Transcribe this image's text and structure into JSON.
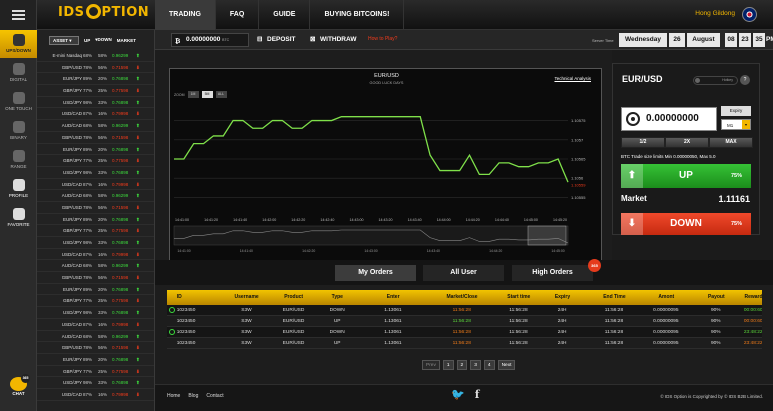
{
  "brand": {
    "logo_left": "IDS",
    "logo_right": "PTION"
  },
  "nav": [
    {
      "label": "TRADING",
      "active": true
    },
    {
      "label": "FAQ"
    },
    {
      "label": "GUIDE"
    },
    {
      "label": "BUYING BITCOINS!"
    }
  ],
  "user": {
    "name": "Hong Gildong"
  },
  "sidebar": [
    {
      "label": "UPS/DOWN",
      "icon": "updown-icon",
      "state": "active"
    },
    {
      "label": "DIGITAL",
      "icon": "digital-icon"
    },
    {
      "label": "ONE TOUCH",
      "icon": "one-touch-icon"
    },
    {
      "label": "BINARY",
      "icon": "binary-icon"
    },
    {
      "label": "RANGE",
      "icon": "range-icon"
    },
    {
      "label": "PROFILE",
      "icon": "profile-icon",
      "state": "on"
    },
    {
      "label": "FAVORITE",
      "icon": "favorite-icon",
      "state": "on"
    }
  ],
  "chat": {
    "label": "CHAT",
    "badge": "365"
  },
  "assets_header": {
    "select": "ASSET",
    "up": "UP",
    "down": "DOWN",
    "market": "MARKET"
  },
  "assets": [
    {
      "name": "E-mini Nasdaq",
      "p1": "68%",
      "p2": "58%",
      "value": "0.96299",
      "dir": "up"
    },
    {
      "name": "GBP/USD",
      "p1": "78%",
      "p2": "56%",
      "value": "0.71598",
      "dir": "down"
    },
    {
      "name": "EUR/JPY",
      "p1": "89%",
      "p2": "20%",
      "value": "0.76898",
      "dir": "up"
    },
    {
      "name": "GBP/JPY",
      "p1": "77%",
      "p2": "25%",
      "value": "0.77598",
      "dir": "down"
    },
    {
      "name": "USD/JPY",
      "p1": "98%",
      "p2": "33%",
      "value": "0.76898",
      "dir": "up"
    },
    {
      "name": "USD/CAD",
      "p1": "87%",
      "p2": "16%",
      "value": "0.79998",
      "dir": "down"
    },
    {
      "name": "AUD/CAD",
      "p1": "68%",
      "p2": "58%",
      "value": "0.96299",
      "dir": "up"
    },
    {
      "name": "GBP/USD",
      "p1": "78%",
      "p2": "56%",
      "value": "0.71598",
      "dir": "down"
    },
    {
      "name": "EUR/JPY",
      "p1": "89%",
      "p2": "20%",
      "value": "0.76898",
      "dir": "up"
    },
    {
      "name": "GBP/JPY",
      "p1": "77%",
      "p2": "25%",
      "value": "0.77598",
      "dir": "down"
    },
    {
      "name": "USD/JPY",
      "p1": "98%",
      "p2": "33%",
      "value": "0.76898",
      "dir": "up"
    },
    {
      "name": "USD/CAD",
      "p1": "87%",
      "p2": "16%",
      "value": "0.79998",
      "dir": "down"
    },
    {
      "name": "AUD/CAD",
      "p1": "68%",
      "p2": "58%",
      "value": "0.96299",
      "dir": "up"
    },
    {
      "name": "GBP/USD",
      "p1": "78%",
      "p2": "56%",
      "value": "0.71598",
      "dir": "down"
    },
    {
      "name": "EUR/JPY",
      "p1": "89%",
      "p2": "20%",
      "value": "0.76898",
      "dir": "up"
    },
    {
      "name": "GBP/JPY",
      "p1": "77%",
      "p2": "25%",
      "value": "0.77598",
      "dir": "down"
    },
    {
      "name": "USD/JPY",
      "p1": "98%",
      "p2": "33%",
      "value": "0.76898",
      "dir": "up"
    },
    {
      "name": "USD/CAD",
      "p1": "87%",
      "p2": "16%",
      "value": "0.79998",
      "dir": "down"
    },
    {
      "name": "AUD/CAD",
      "p1": "68%",
      "p2": "58%",
      "value": "0.96299",
      "dir": "up"
    },
    {
      "name": "GBP/USD",
      "p1": "78%",
      "p2": "56%",
      "value": "0.71598",
      "dir": "down"
    },
    {
      "name": "EUR/JPY",
      "p1": "89%",
      "p2": "20%",
      "value": "0.76898",
      "dir": "up"
    },
    {
      "name": "GBP/JPY",
      "p1": "77%",
      "p2": "25%",
      "value": "0.77598",
      "dir": "down"
    },
    {
      "name": "USD/JPY",
      "p1": "98%",
      "p2": "33%",
      "value": "0.76898",
      "dir": "up"
    },
    {
      "name": "USD/CAD",
      "p1": "87%",
      "p2": "16%",
      "value": "0.79998",
      "dir": "down"
    },
    {
      "name": "AUD/CAD",
      "p1": "68%",
      "p2": "58%",
      "value": "0.96299",
      "dir": "up"
    },
    {
      "name": "GBP/USD",
      "p1": "78%",
      "p2": "56%",
      "value": "0.71598",
      "dir": "down"
    },
    {
      "name": "EUR/JPY",
      "p1": "89%",
      "p2": "20%",
      "value": "0.76898",
      "dir": "up"
    },
    {
      "name": "GBP/JPY",
      "p1": "77%",
      "p2": "25%",
      "value": "0.77598",
      "dir": "down"
    },
    {
      "name": "USD/JPY",
      "p1": "98%",
      "p2": "33%",
      "value": "0.76898",
      "dir": "up"
    },
    {
      "name": "USD/CAD",
      "p1": "87%",
      "p2": "16%",
      "value": "0.79998",
      "dir": "down"
    }
  ],
  "actionbar": {
    "balance": "0.00000000",
    "balance_unit": "BTC",
    "deposit": "DEPOSIT",
    "withdraw": "WITHDRAW",
    "howto": "How to Play?",
    "server_time_label": "Server Time",
    "weekday": "Wednesday",
    "day": "26",
    "month": "August",
    "hh": "08",
    "mm": "23",
    "ss": "35",
    "ampm": "PM"
  },
  "chart_data": {
    "type": "line",
    "title": "EUR/USD",
    "subtitle": "GOOD LUCK DAYS",
    "technical_link": "Technical Analysis",
    "zoom_label": "ZOOM",
    "zoom_options": [
      {
        "label": "1M"
      },
      {
        "label": "5M",
        "active": true
      },
      {
        "label": "ALL"
      }
    ],
    "x_ticks": [
      "14:41:00",
      "14:41:20",
      "14:41:40",
      "14:42:00",
      "14:42:20",
      "14:42:40",
      "14:43:00",
      "14:43:20",
      "14:43:40",
      "14:44:00",
      "14:44:20",
      "14:44:40",
      "14:45:00",
      "14:45:20"
    ],
    "navigator_ticks": [
      "14:41:00",
      "14:41:40",
      "14:42:20",
      "14:43:00",
      "14:43:40",
      "14:44:20",
      "14:45:00"
    ],
    "y_ticks": [
      "1.10575",
      "1.1057",
      "1.10565",
      "1.1056",
      "1.10555"
    ],
    "ylim": [
      1.10552,
      1.10578
    ],
    "current_value": "1.10559",
    "series": [
      {
        "values": [
          1.10565,
          1.10565,
          1.10569,
          1.10569,
          1.10571,
          1.10571,
          1.10575,
          1.10575,
          1.10573,
          1.10573,
          1.10575,
          1.10575,
          1.10573,
          1.10573,
          1.10575,
          1.10575,
          1.10575,
          1.10576,
          1.10576,
          1.10576,
          1.10576,
          1.10576,
          1.10576,
          1.10576,
          1.10576,
          1.10576,
          1.10566,
          1.10562,
          1.10562,
          1.10562,
          1.10566,
          1.10561,
          1.10561,
          1.10564,
          1.10564,
          1.10563,
          1.10563,
          1.10564,
          1.10564,
          1.10565,
          1.10559
        ]
      }
    ]
  },
  "trade": {
    "pair": "EUR/USD",
    "hotkey": "Hotkey",
    "help": "?",
    "amount": "0.00000000",
    "expiry_label": "Expiry",
    "expiry_value": "M1",
    "multipliers": [
      "1/2",
      "2X",
      "MAX"
    ],
    "limits": "BTC Trade size limits Min 0.00000050, Max 5.0",
    "up_label": "UP",
    "up_pct": "75%",
    "market_label": "Market",
    "market_value": "1.11161",
    "down_label": "DOWN",
    "down_pct": "75%"
  },
  "orders": {
    "tabs": [
      {
        "label": "My Orders",
        "active": true
      },
      {
        "label": "All User"
      },
      {
        "label": "High Orders",
        "badge": "365"
      }
    ],
    "columns": [
      "ID",
      "Username",
      "Product",
      "Type",
      "Enter",
      "Market/Close",
      "Start time",
      "Expiry",
      "End Time",
      "Amont",
      "Payout",
      "Reward"
    ],
    "rows": [
      {
        "icon": true,
        "id": "1023450",
        "user": "S3W",
        "product": "EUR/USD",
        "type": "DOWN",
        "enter": "1.13061",
        "close": "11:56:28",
        "close_color": "otxt",
        "start": "11:56:28",
        "expiry": "24H",
        "end": "11:56:28",
        "amount": "0.00000095",
        "payout": "90%",
        "reward": "00:00:60",
        "reward_color": "gtxt"
      },
      {
        "icon": false,
        "id": "1023450",
        "user": "S3W",
        "product": "EUR/USD",
        "type": "UP",
        "enter": "1.13061",
        "close": "11:56:28",
        "close_color": "gtxt",
        "start": "11:56:28",
        "expiry": "24H",
        "end": "11:56:28",
        "amount": "0.00000095",
        "payout": "90%",
        "reward": "00:00:60",
        "reward_color": "otxt"
      },
      {
        "icon": true,
        "id": "1023450",
        "user": "S3W",
        "product": "EUR/USD",
        "type": "DOWN",
        "enter": "1.13061",
        "close": "11:56:28",
        "close_color": "otxt",
        "start": "11:56:28",
        "expiry": "24H",
        "end": "11:56:28",
        "amount": "0.00000095",
        "payout": "90%",
        "reward": "23:48:22",
        "reward_color": "gtxt"
      },
      {
        "icon": false,
        "id": "1023450",
        "user": "S3W",
        "product": "EUR/USD",
        "type": "UP",
        "enter": "1.13061",
        "close": "11:56:28",
        "close_color": "otxt",
        "start": "11:56:28",
        "expiry": "24H",
        "end": "11:56:28",
        "amount": "0.00000095",
        "payout": "90%",
        "reward": "23:48:22",
        "reward_color": "otxt"
      }
    ],
    "pager": [
      {
        "label": "Prev",
        "disabled": true
      },
      {
        "label": "1"
      },
      {
        "label": "2"
      },
      {
        "label": "3"
      },
      {
        "label": "4"
      },
      {
        "label": "Next"
      }
    ]
  },
  "footer": {
    "links": [
      "Home",
      "Blog",
      "Contact"
    ],
    "copyright": "© IDS Option is Copyrighted by © IDS B2B Limited."
  },
  "colors": {
    "accent": "#f2b600",
    "up": "#3ddc3d",
    "down": "#f23b1c",
    "line": "#7fe04a"
  }
}
